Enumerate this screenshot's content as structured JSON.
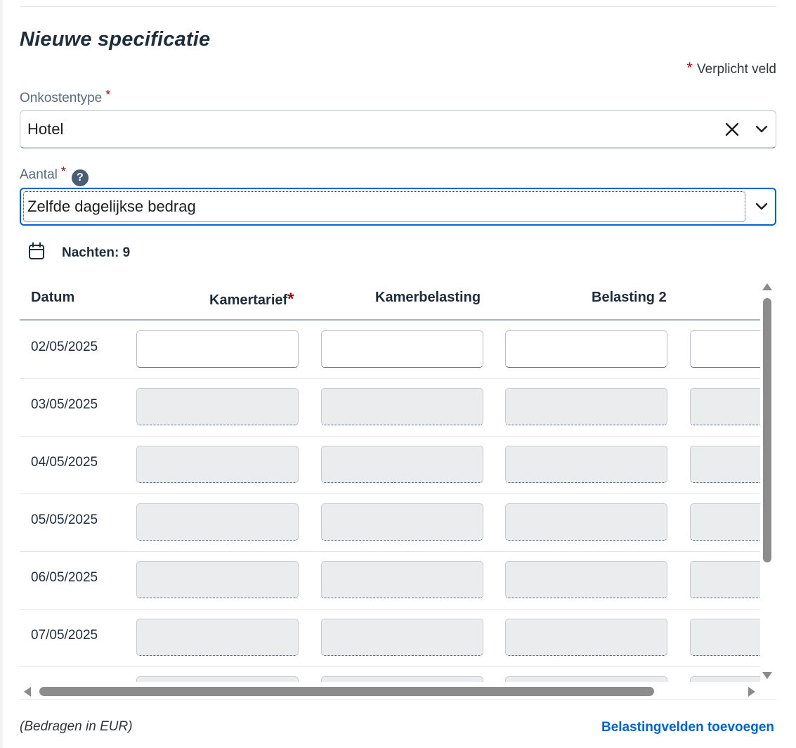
{
  "form": {
    "title": "Nieuwe specificatie",
    "required_star": "*",
    "required_note": "Verplicht veld"
  },
  "expense_type": {
    "label": "Onkostentype",
    "required": "*",
    "value": "Hotel"
  },
  "amount": {
    "label": "Aantal",
    "required": "*",
    "help": "?",
    "value": "Zelfde dagelijkse bedrag"
  },
  "nights": {
    "label": "Nachten: 9"
  },
  "table": {
    "columns": {
      "date": "Datum",
      "room_rate": "Kamertarief",
      "room_rate_required": "*",
      "room_tax": "Kamerbelasting",
      "tax2": "Belasting 2"
    },
    "rows": [
      {
        "date": "02/05/2025"
      },
      {
        "date": "03/05/2025"
      },
      {
        "date": "04/05/2025"
      },
      {
        "date": "05/05/2025"
      },
      {
        "date": "06/05/2025"
      },
      {
        "date": "07/05/2025"
      }
    ]
  },
  "footer": {
    "currency_note": "(Bedragen in EUR)",
    "add_tax_fields_link": "Belastingvelden toevoegen"
  },
  "colors": {
    "accent": "#0064d9",
    "required": "#aa0808",
    "disabled_input": "#eaecee"
  }
}
